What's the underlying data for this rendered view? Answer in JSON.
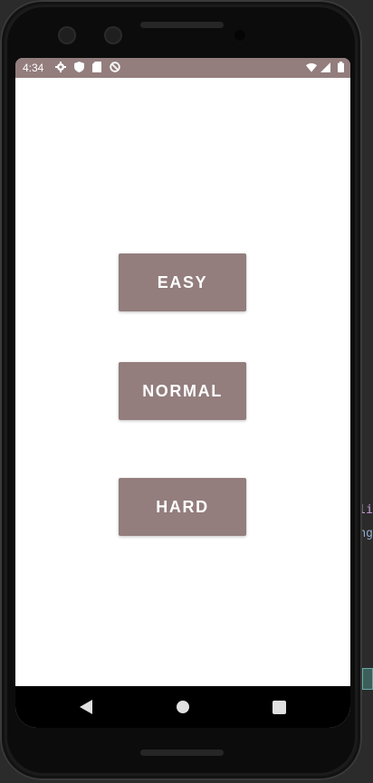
{
  "status_bar": {
    "time": "4:34",
    "icons_left": [
      "gear-icon",
      "shield-icon",
      "sd-card-icon",
      "no-sync-icon"
    ],
    "icons_right": [
      "wifi-icon",
      "signal-icon",
      "battery-icon"
    ],
    "color": "#937d7d"
  },
  "menu": {
    "buttons": [
      {
        "label": "EASY"
      },
      {
        "label": "NORMAL"
      },
      {
        "label": "HARD"
      }
    ],
    "button_color": "#937d7d",
    "text_color": "#ffffff"
  },
  "nav_bar": {
    "buttons": [
      "back-icon",
      "home-icon",
      "recents-icon"
    ]
  },
  "ide": {
    "line1": "li",
    "line2": "ng"
  }
}
